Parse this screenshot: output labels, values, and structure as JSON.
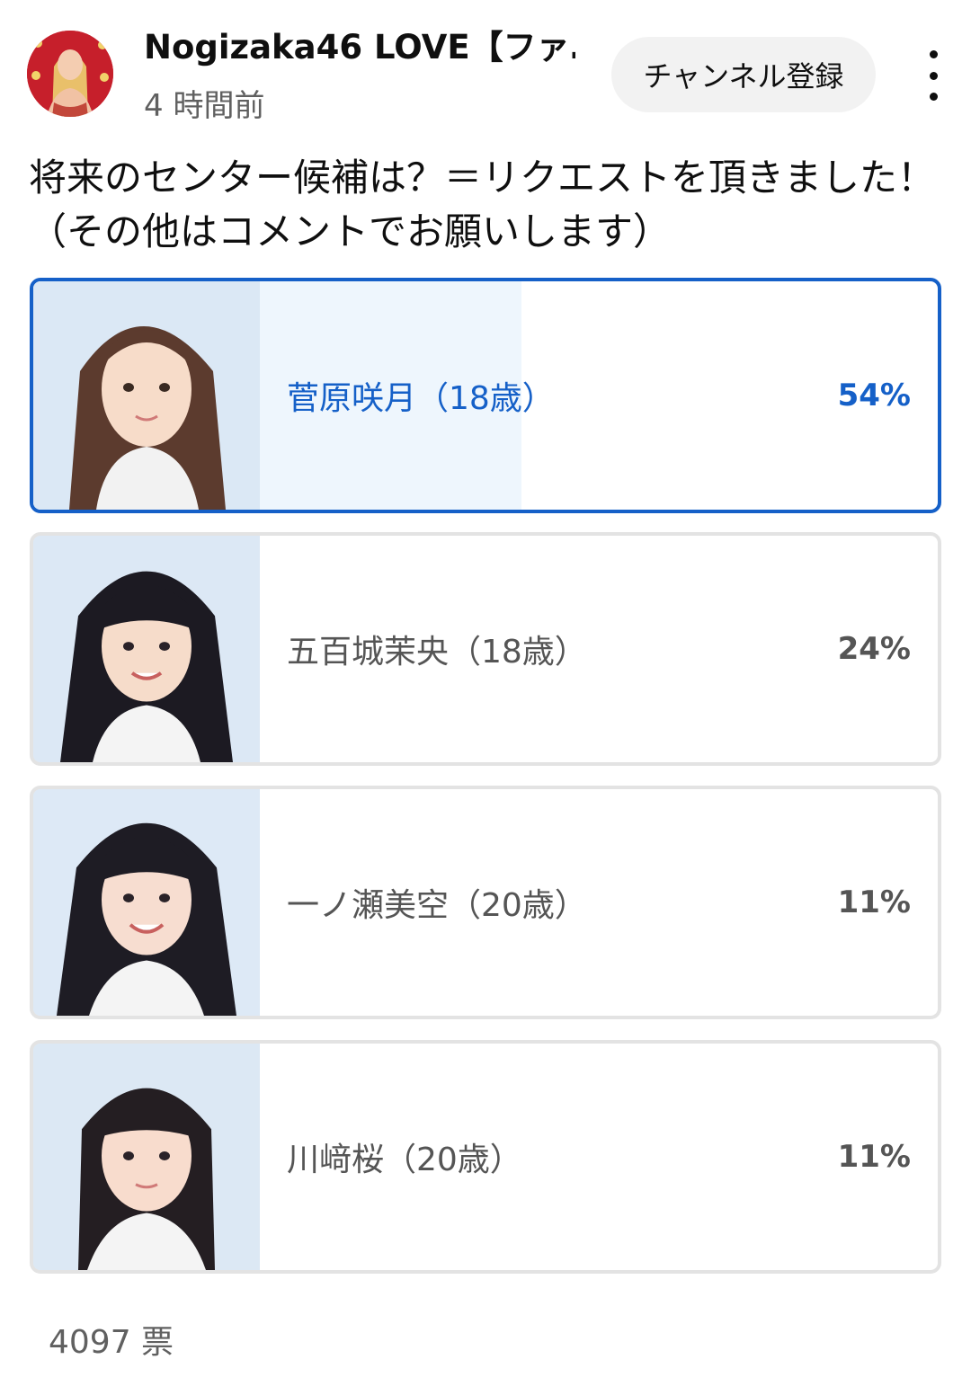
{
  "header": {
    "channel_name": "Nogizaka46 LOVE【ファ…",
    "time": "4 時間前",
    "subscribe_label": "チャンネル登録",
    "avatar_icon": "channel-avatar",
    "more_icon": "more-vert-icon"
  },
  "question": "将来のセンター候補は？＝リクエストを頂きました！（その他はコメントでお願いします）",
  "poll": {
    "options": [
      {
        "label": "菅原咲月（18歳）",
        "percent_text": "54%",
        "percent": 54,
        "selected": true
      },
      {
        "label": "五百城茉央（18歳）",
        "percent_text": "24%",
        "percent": 24,
        "selected": false
      },
      {
        "label": "一ノ瀬美空（20歳）",
        "percent_text": "11%",
        "percent": 11,
        "selected": false
      },
      {
        "label": "川﨑桜（20歳）",
        "percent_text": "11%",
        "percent": 11,
        "selected": false
      }
    ],
    "votes": "4097 票"
  },
  "colors": {
    "accent": "#1560c8",
    "selected_fill": "#eef6fd",
    "fill": "#e5e5e5",
    "border": "#e3e3e3",
    "subscribe_bg": "#f2f2f2"
  }
}
